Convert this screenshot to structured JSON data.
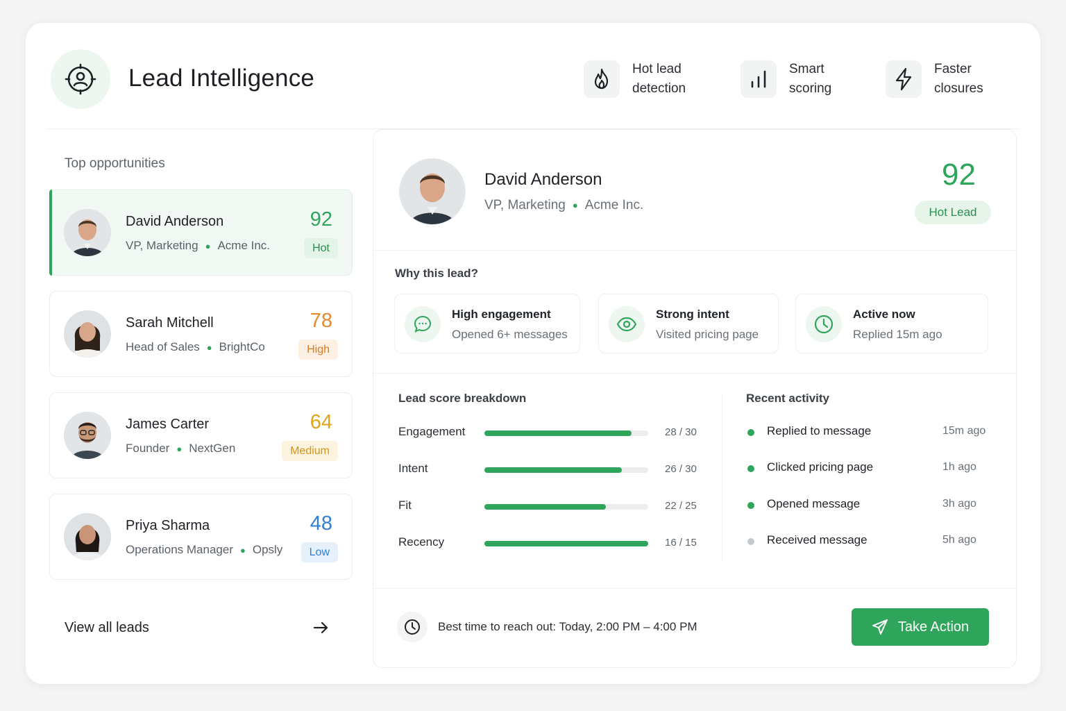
{
  "app": {
    "title": "Lead Intelligence"
  },
  "features": [
    {
      "icon": "flame-icon",
      "line1": "Hot lead",
      "line2": "detection"
    },
    {
      "icon": "bar-chart-icon",
      "line1": "Smart",
      "line2": "scoring"
    },
    {
      "icon": "lightning-icon",
      "line1": "Faster",
      "line2": "closures"
    }
  ],
  "opportunities": {
    "heading": "Top opportunities",
    "leads": [
      {
        "name": "David Anderson",
        "role": "VP, Marketing",
        "company": "Acme Inc.",
        "score": "92",
        "badge": "Hot",
        "score_color": "#2ea55b",
        "badge_bg": "#e3f3e8",
        "badge_color": "#2a8f4f"
      },
      {
        "name": "Sarah Mitchell",
        "role": "Head of Sales",
        "company": "BrightCo",
        "score": "78",
        "badge": "High",
        "score_color": "#e8872c",
        "badge_bg": "#fdf0e3",
        "badge_color": "#e07a1f"
      },
      {
        "name": "James Carter",
        "role": "Founder",
        "company": "NextGen",
        "score": "64",
        "badge": "Medium",
        "score_color": "#e3a21a",
        "badge_bg": "#fdf4df",
        "badge_color": "#d69414"
      },
      {
        "name": "Priya Sharma",
        "role": "Operations Manager",
        "company": "Opsly",
        "score": "48",
        "badge": "Low",
        "score_color": "#2f7fd8",
        "badge_bg": "#e6f0fb",
        "badge_color": "#2f7fd8"
      }
    ],
    "view_all": "View all leads"
  },
  "detail": {
    "name": "David Anderson",
    "role": "VP, Marketing",
    "company": "Acme Inc.",
    "score": "92",
    "badge": "Hot Lead",
    "why_title": "Why this lead?",
    "reasons": [
      {
        "icon": "chat-icon",
        "title": "High engagement",
        "subtitle": "Opened 6+ messages"
      },
      {
        "icon": "eye-icon",
        "title": "Strong intent",
        "subtitle": "Visited pricing page"
      },
      {
        "icon": "clock-icon",
        "title": "Active now",
        "subtitle": "Replied 15m ago"
      }
    ],
    "breakdown_title": "Lead score breakdown",
    "breakdown": [
      {
        "label": "Engagement",
        "value": "28 / 30",
        "fraction": 0.9
      },
      {
        "label": "Intent",
        "value": "26 / 30",
        "fraction": 0.84
      },
      {
        "label": "Fit",
        "value": "22 / 25",
        "fraction": 0.74
      },
      {
        "label": "Recency",
        "value": "16 / 15",
        "fraction": 1.0
      }
    ],
    "activity_title": "Recent activity",
    "activity": [
      {
        "label": "Replied to message",
        "time": "15m ago",
        "color": "#2ea55b"
      },
      {
        "label": "Clicked pricing page",
        "time": "1h ago",
        "color": "#2ea55b"
      },
      {
        "label": "Opened message",
        "time": "3h ago",
        "color": "#2ea55b"
      },
      {
        "label": "Received message",
        "time": "5h ago",
        "color": "#c4c8cc"
      }
    ],
    "best_time": "Best time to reach out: Today, 2:00 PM – 4:00 PM",
    "action_label": "Take Action"
  },
  "colors": {
    "accent": "#2ea55b"
  }
}
